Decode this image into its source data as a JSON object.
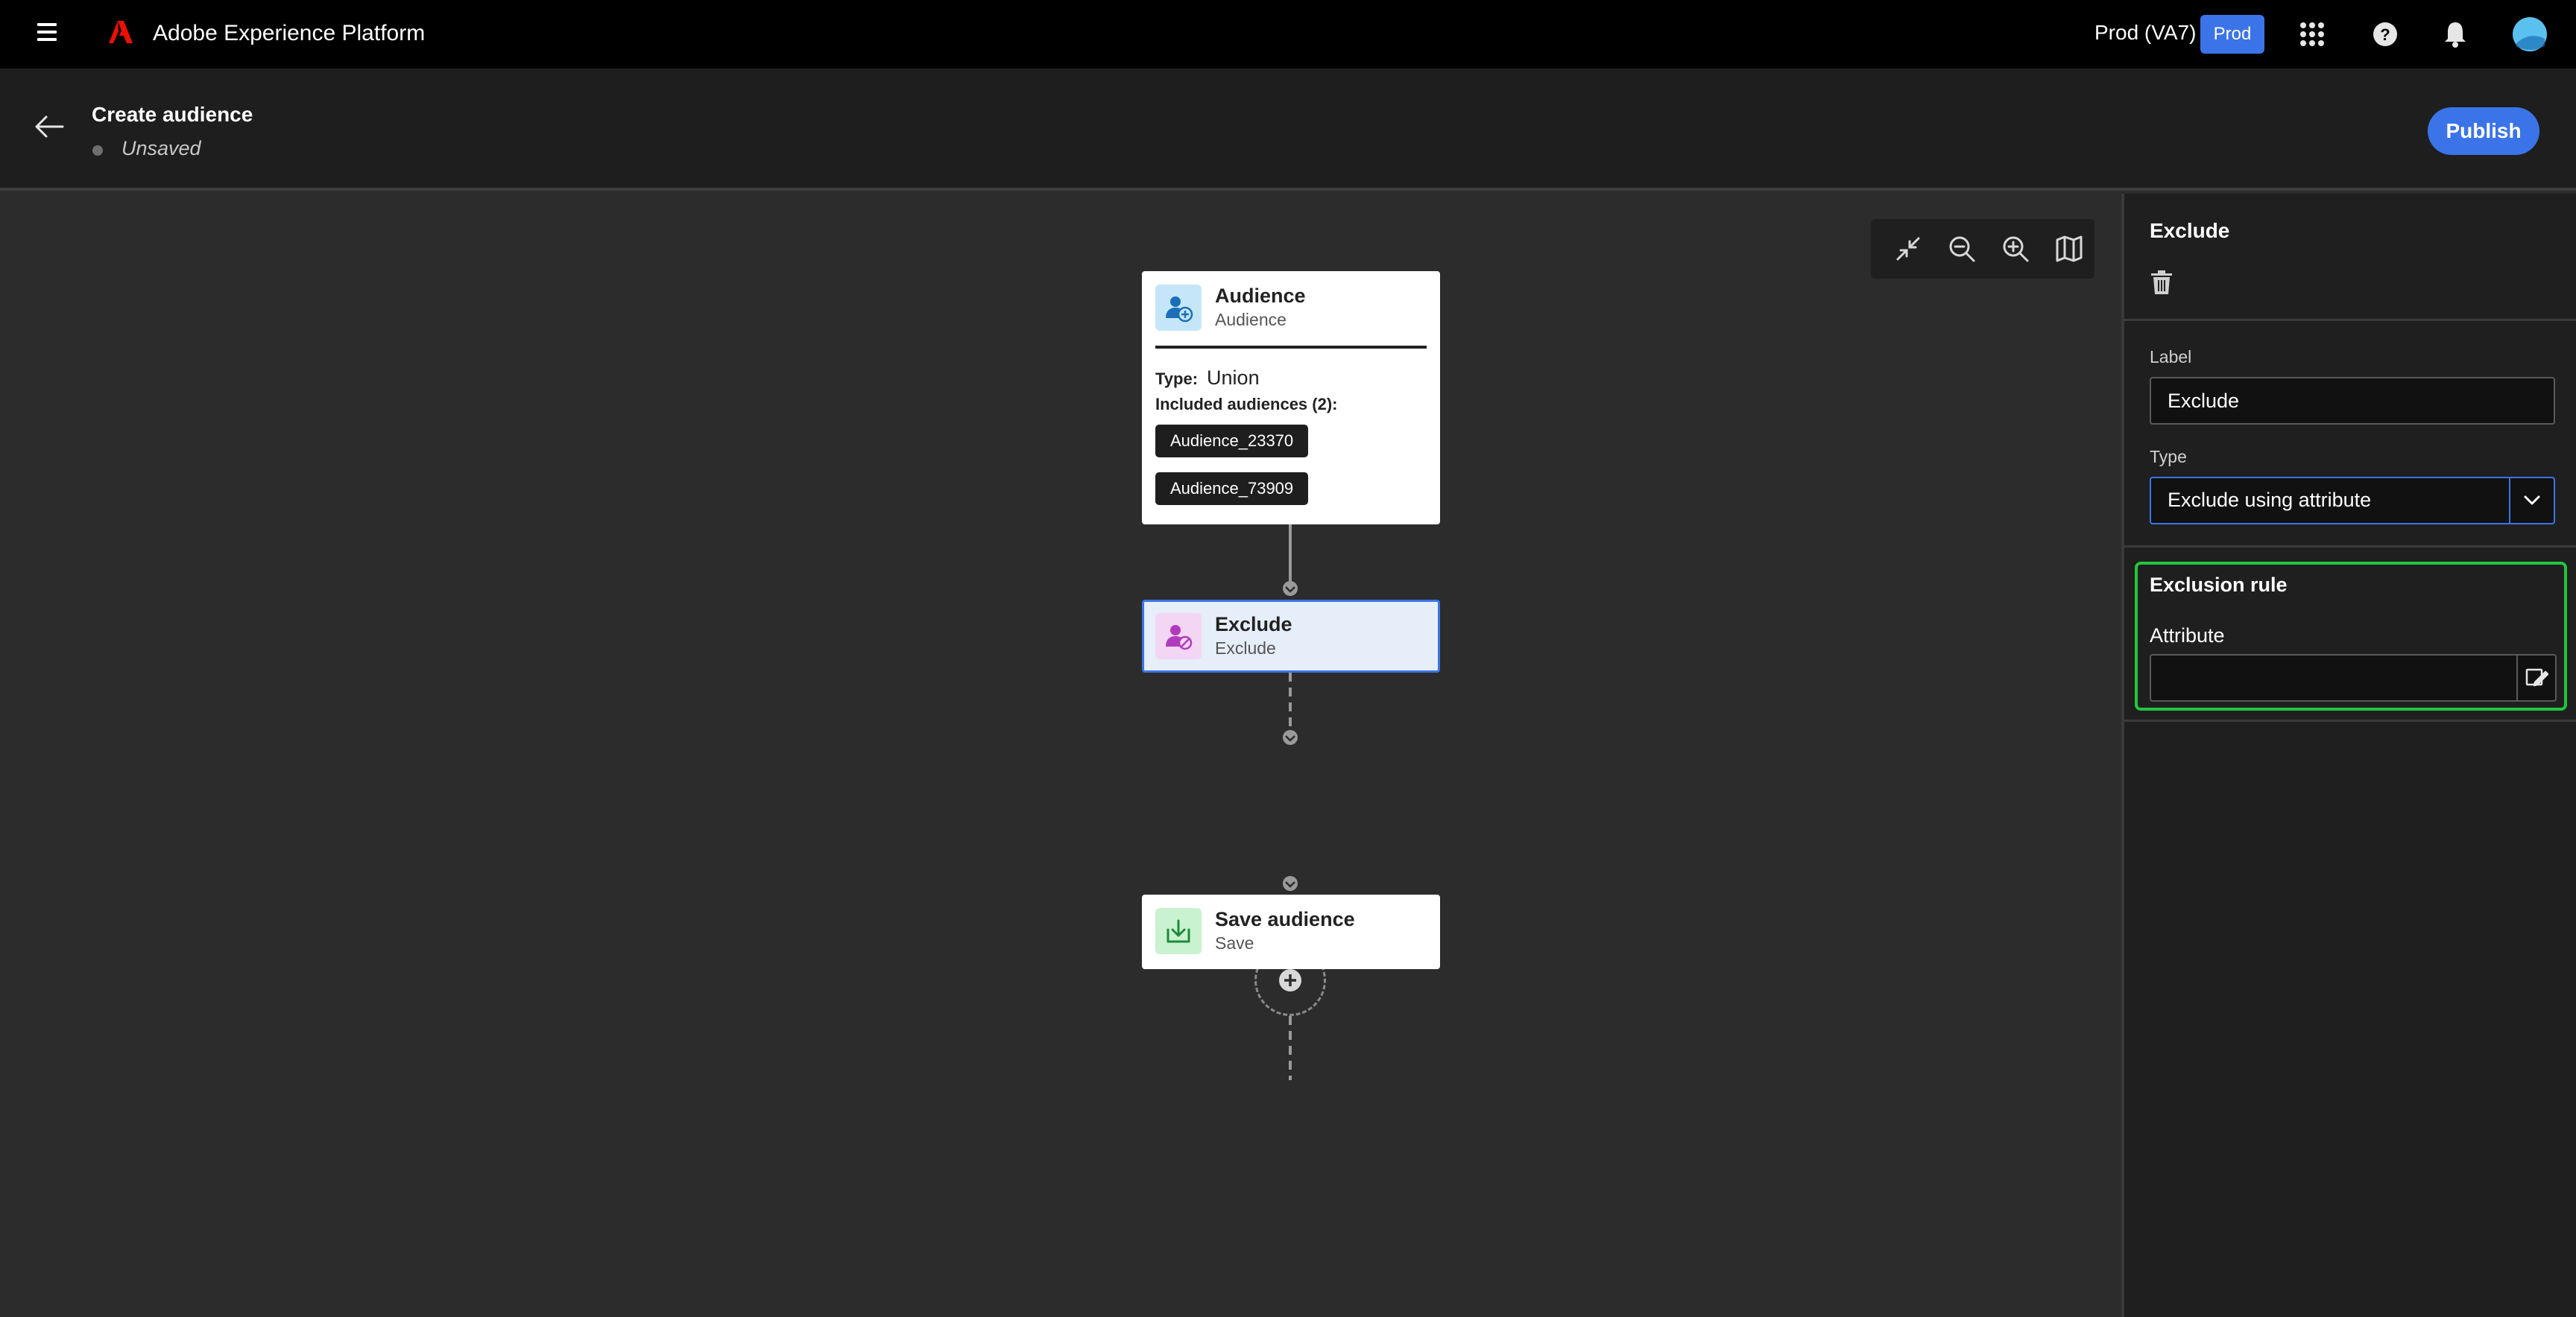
{
  "topbar": {
    "app_title": "Adobe Experience Platform",
    "org_name": "Prod (VA7)",
    "env_badge": "Prod",
    "icons": [
      "hamburger-menu-icon",
      "adobe-logo",
      "app-switcher-grid-icon",
      "help-icon",
      "notifications-bell-icon",
      "user-avatar"
    ]
  },
  "header": {
    "title": "Create audience",
    "status": "Unsaved",
    "publish_label": "Publish"
  },
  "canvas": {
    "toolbar_icons": [
      "collapse-icon",
      "zoom-out-icon",
      "zoom-in-icon",
      "minimap-icon"
    ],
    "nodes": {
      "audience": {
        "title": "Audience",
        "subtitle": "Audience",
        "type_label": "Type:",
        "type_value": "Union",
        "included_label": "Included audiences (2):",
        "included": [
          "Audience_23370",
          "Audience_73909"
        ]
      },
      "exclude": {
        "title": "Exclude",
        "subtitle": "Exclude"
      },
      "save": {
        "title": "Save audience",
        "subtitle": "Save"
      }
    }
  },
  "panel": {
    "title": "Exclude",
    "label_field_label": "Label",
    "label_value": "Exclude",
    "type_field_label": "Type",
    "type_value": "Exclude using attribute",
    "rule_title": "Exclusion rule",
    "attribute_label": "Attribute",
    "attribute_value": ""
  },
  "colors": {
    "accent_blue": "#3b74e8",
    "highlight_green": "#21c63d",
    "adobe_red": "#eb1000"
  }
}
